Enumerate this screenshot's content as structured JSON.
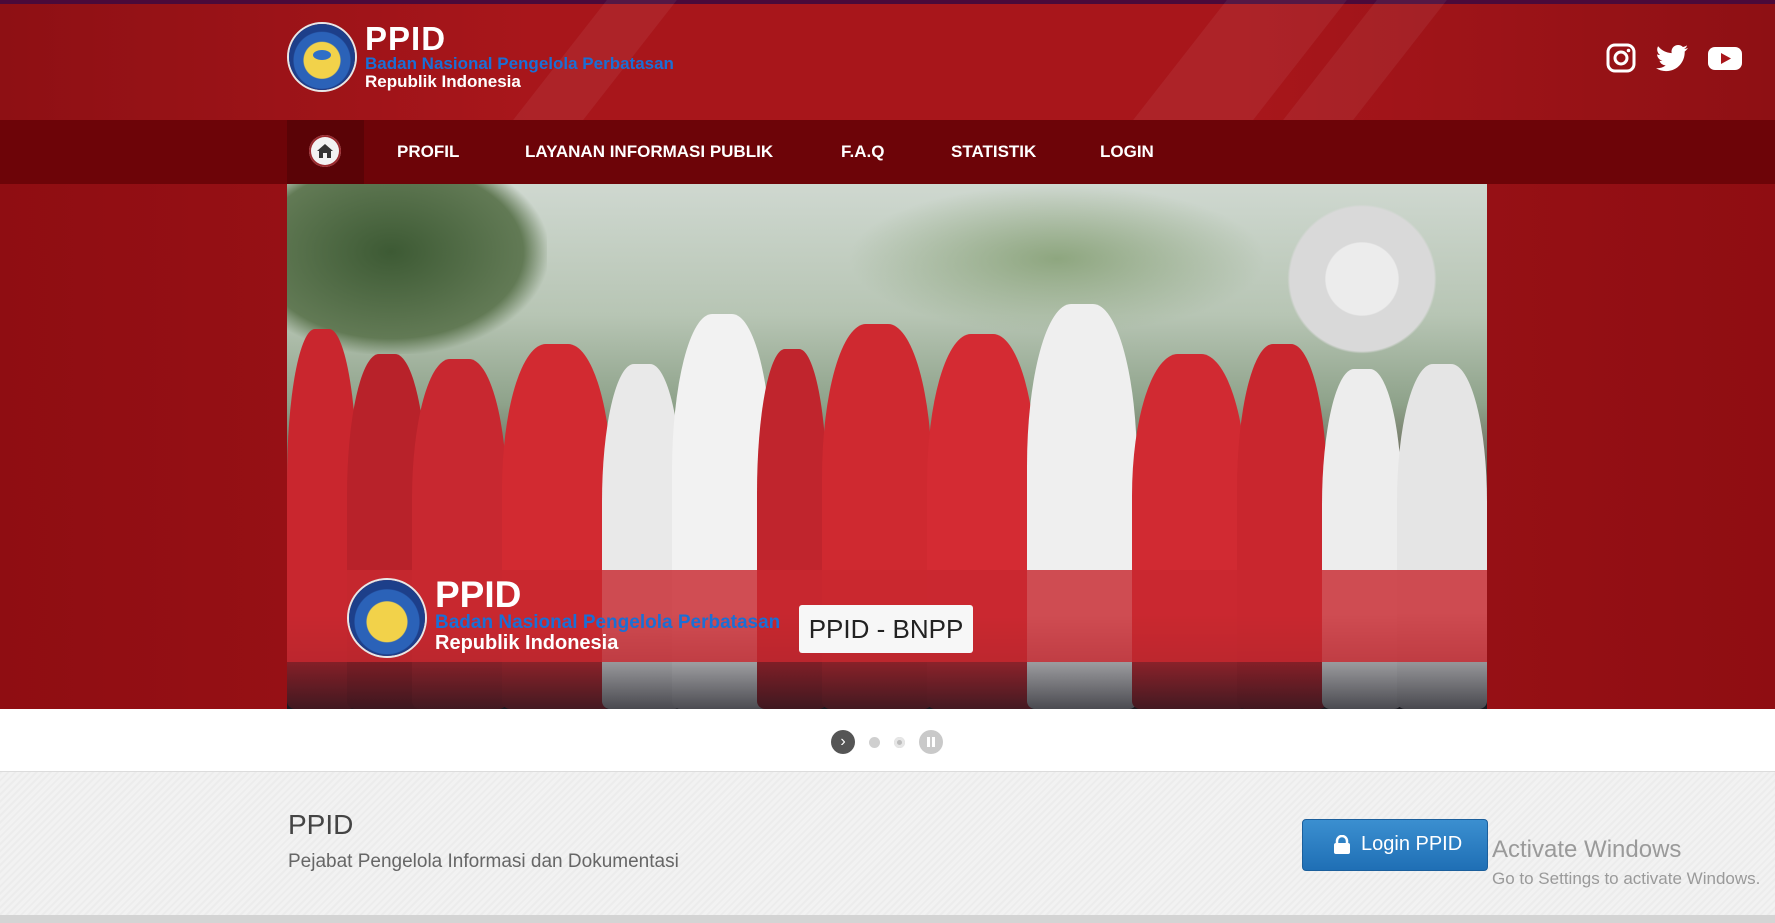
{
  "header": {
    "logo_title": "PPID",
    "logo_subtitle_1": "Badan Nasional Pengelola Perbatasan",
    "logo_subtitle_2": "Republik Indonesia",
    "social": [
      "instagram-icon",
      "twitter-icon",
      "youtube-icon"
    ]
  },
  "nav": {
    "home_icon": "home-icon",
    "items": [
      {
        "label": "PROFIL"
      },
      {
        "label": "LAYANAN INFORMASI PUBLIK"
      },
      {
        "label": "F.A.Q"
      },
      {
        "label": "STATISTIK"
      },
      {
        "label": "LOGIN"
      }
    ]
  },
  "slider": {
    "overlay_title": "PPID",
    "overlay_subtitle_1": "Badan Nasional Pengelola Perbatasan",
    "overlay_subtitle_2": "Republik Indonesia",
    "caption": "PPID - BNPP",
    "controls": [
      "next-icon",
      "dot",
      "dot",
      "pause-icon"
    ]
  },
  "info": {
    "title": "PPID",
    "description": "Pejabat Pengelola Informasi dan Dokumentasi",
    "login_button": "Login PPID"
  },
  "watermark": {
    "line1": "Activate Windows",
    "line2": "Go to Settings to activate Windows."
  },
  "colors": {
    "header_red": "#a8161b",
    "nav_dark_red": "#6d0408",
    "login_blue": "#2a7fc4"
  }
}
